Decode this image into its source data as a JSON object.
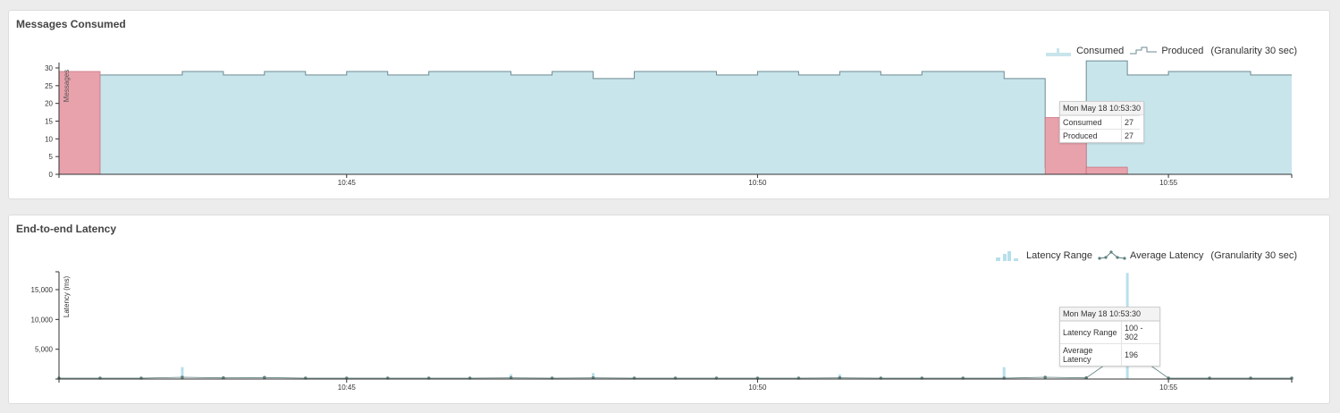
{
  "panels": {
    "consumed": {
      "title": "Messages Consumed",
      "legend": {
        "consumed": "Consumed",
        "produced": "Produced",
        "granularity": "(Granularity 30 sec)"
      },
      "tooltip": {
        "time": "Mon May 18 10:53:30",
        "rows": [
          {
            "label": "Consumed",
            "value": "27"
          },
          {
            "label": "Produced",
            "value": "27"
          }
        ]
      }
    },
    "latency": {
      "title": "End-to-end Latency",
      "legend": {
        "range": "Latency Range",
        "average": "Average Latency",
        "granularity": "(Granularity 30 sec)"
      },
      "tooltip": {
        "time": "Mon May 18 10:53:30",
        "rows": [
          {
            "label": "Latency Range",
            "value": "100 - 302"
          },
          {
            "label": "Average Latency",
            "value": "196"
          }
        ]
      }
    }
  },
  "colors": {
    "fill": "#c8e5ec",
    "stroke": "#6e8a93",
    "under": "#e8a2ac",
    "underStroke": "#c9737f",
    "point": "#5e7f7d",
    "rangeBar": "#b7e0ea"
  },
  "chart_data": [
    {
      "type": "area",
      "title": "Messages Consumed",
      "ylabel": "Messages",
      "ylim": [
        0,
        30
      ],
      "yticks": [
        "0",
        "5",
        "10",
        "15",
        "20",
        "25",
        "30"
      ],
      "xlim": [
        "10:41:30",
        "10:56:30"
      ],
      "xticks": [
        {
          "t": 645,
          "label": "10:45"
        },
        {
          "t": 945,
          "label": "10:50"
        },
        {
          "t": 1245,
          "label": "10:55"
        }
      ],
      "interval_start_seconds": [
        0,
        30,
        60,
        90,
        120,
        150,
        180,
        210,
        240,
        270,
        300,
        330,
        360,
        390,
        420,
        450,
        480,
        510,
        540,
        570,
        600,
        630,
        660,
        690,
        720,
        750,
        780,
        810,
        840,
        870
      ],
      "series": [
        {
          "name": "Consumed",
          "values": [
            29,
            28,
            28,
            29,
            28,
            29,
            28,
            29,
            28,
            29,
            29,
            28,
            29,
            27,
            29,
            29,
            28,
            29,
            28,
            29,
            28,
            29,
            29,
            27,
            16,
            2,
            0,
            0,
            0,
            0
          ]
        },
        {
          "name": "Produced",
          "values": [
            28,
            28,
            28,
            29,
            28,
            29,
            28,
            29,
            28,
            29,
            29,
            28,
            29,
            27,
            29,
            29,
            28,
            29,
            28,
            29,
            28,
            29,
            29,
            27,
            2,
            32,
            28,
            29,
            29,
            28
          ]
        }
      ]
    },
    {
      "type": "line",
      "title": "End-to-end Latency",
      "ylabel": "Latency (ms)",
      "ylim": [
        0,
        18000
      ],
      "yticks": [
        {
          "v": 5000,
          "label": "5,000"
        },
        {
          "v": 10000,
          "label": "10,000"
        },
        {
          "v": 15000,
          "label": "15,000"
        }
      ],
      "xlim": [
        "10:41:30",
        "10:56:30"
      ],
      "xticks": [
        {
          "t": 645,
          "label": "10:45"
        },
        {
          "t": 945,
          "label": "10:50"
        },
        {
          "t": 1245,
          "label": "10:55"
        }
      ],
      "series": [
        {
          "name": "Average Latency",
          "x": [
            0,
            30,
            60,
            90,
            120,
            150,
            180,
            210,
            240,
            270,
            300,
            330,
            360,
            390,
            420,
            450,
            480,
            510,
            540,
            570,
            600,
            630,
            660,
            690,
            720,
            750,
            780,
            810,
            840,
            870,
            900
          ],
          "values": [
            150,
            150,
            150,
            300,
            200,
            250,
            150,
            150,
            150,
            150,
            150,
            200,
            150,
            200,
            150,
            150,
            150,
            150,
            150,
            200,
            150,
            150,
            150,
            150,
            300,
            196,
            5000,
            150,
            150,
            150,
            150
          ]
        },
        {
          "name": "Latency Range",
          "bars": [
            {
              "x": 90,
              "low": 0,
              "high": 2000
            },
            {
              "x": 330,
              "low": 0,
              "high": 800
            },
            {
              "x": 390,
              "low": 0,
              "high": 1000
            },
            {
              "x": 570,
              "low": 0,
              "high": 800
            },
            {
              "x": 690,
              "low": 0,
              "high": 2000
            },
            {
              "x": 780,
              "low": 0,
              "high": 17800
            }
          ]
        }
      ]
    }
  ]
}
